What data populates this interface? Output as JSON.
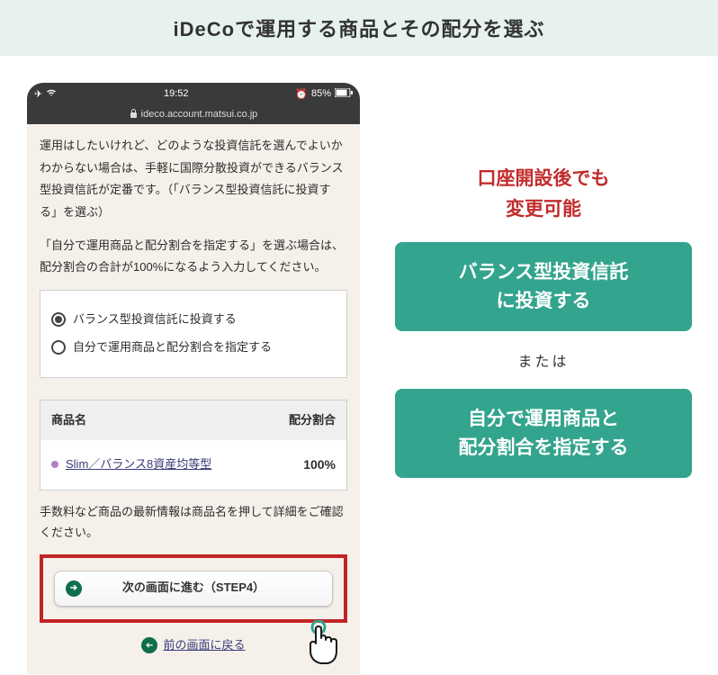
{
  "banner": {
    "title": "iDeCoで運用する商品とその配分を選ぶ"
  },
  "phone": {
    "status": {
      "time": "19:52",
      "battery": "85%",
      "url": "ideco.account.matsui.co.jp"
    },
    "para1": "運用はしたいけれど、どのような投資信託を選んでよいかわからない場合は、手軽に国際分散投資ができるバランス型投資信託が定番です。（「バランス型投資信託に投資する」を選ぶ）",
    "para2": "「自分で運用商品と配分割合を指定する」を選ぶ場合は、配分割合の合計が100%になるよう入力してください。",
    "radio": {
      "option1": "バランス型投資信託に投資する",
      "option2": "自分で運用商品と配分割合を指定する"
    },
    "table": {
      "header_name": "商品名",
      "header_ratio": "配分割合",
      "rows": [
        {
          "name": "Slim／バランス8資産均等型",
          "ratio": "100%"
        }
      ]
    },
    "fee_note": "手数料など商品の最新情報は商品名を押して詳細をご確認ください。",
    "next_label": "次の画面に進む（STEP4）",
    "back_label": "前の画面に戻る"
  },
  "right": {
    "notice_line1": "口座開設後でも",
    "notice_line2": "変更可能",
    "choice1_line1": "バランス型投資信託",
    "choice1_line2": "に投資する",
    "or": "または",
    "choice2_line1": "自分で運用商品と",
    "choice2_line2": "配分割合を指定する"
  }
}
